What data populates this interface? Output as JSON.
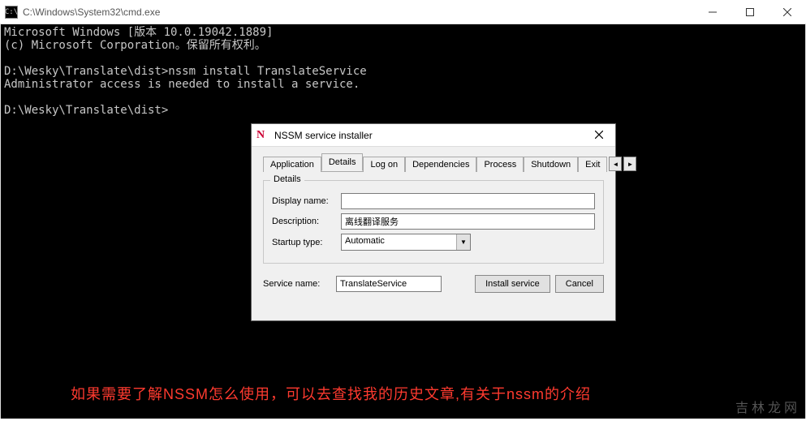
{
  "window": {
    "title": "C:\\Windows\\System32\\cmd.exe",
    "icon_glyph": "C:\\"
  },
  "console": {
    "lines": "Microsoft Windows [版本 10.0.19042.1889]\n(c) Microsoft Corporation。保留所有权利。\n\nD:\\Wesky\\Translate\\dist>nssm install TranslateService\nAdministrator access is needed to install a service.\n\nD:\\Wesky\\Translate\\dist>"
  },
  "overlay": {
    "text": "如果需要了解NSSM怎么使用，可以去查找我的历史文章,有关于nssm的介绍"
  },
  "watermark": "吉林龙网",
  "dialog": {
    "icon_letter": "N",
    "title": "NSSM service installer",
    "tabs": [
      "Application",
      "Details",
      "Log on",
      "Dependencies",
      "Process",
      "Shutdown",
      "Exit"
    ],
    "active_tab": "Details",
    "details": {
      "group_label": "Details",
      "display_name_label": "Display name:",
      "display_name_value": "",
      "description_label": "Description:",
      "description_value": "离线翻译服务",
      "startup_label": "Startup type:",
      "startup_value": "Automatic"
    },
    "footer": {
      "service_name_label": "Service name:",
      "service_name_value": "TranslateService",
      "install_label": "Install service",
      "cancel_label": "Cancel"
    }
  }
}
